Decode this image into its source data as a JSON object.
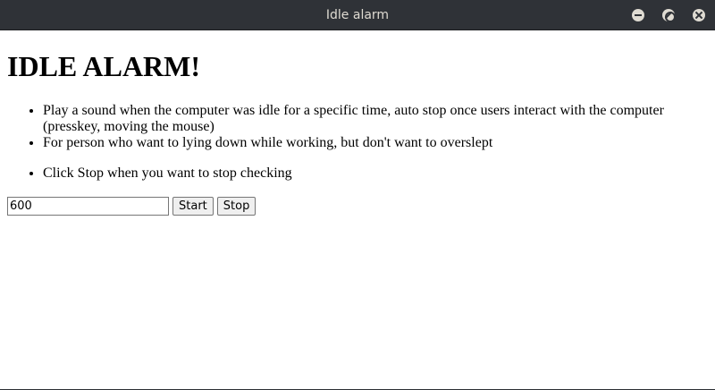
{
  "window": {
    "title": "Idle alarm"
  },
  "page": {
    "heading": "IDLE ALARM!",
    "features": [
      "Play a sound when the computer was idle for a specific time, auto stop once users interact with the computer (presskey, moving the mouse)",
      "For person who want to lying down while working, but don't want to overslept"
    ],
    "instructions": [
      "Click Stop when you want to stop checking"
    ]
  },
  "controls": {
    "timeout_value": "600",
    "start_label": "Start",
    "stop_label": "Stop"
  },
  "icons": {
    "minimize": "minimize-icon",
    "restore": "restore-icon",
    "close": "close-icon"
  },
  "colors": {
    "titlebar_bg": "#2f3237",
    "titlebar_text": "#dfdbd2",
    "page_bg": "#ffffff"
  }
}
